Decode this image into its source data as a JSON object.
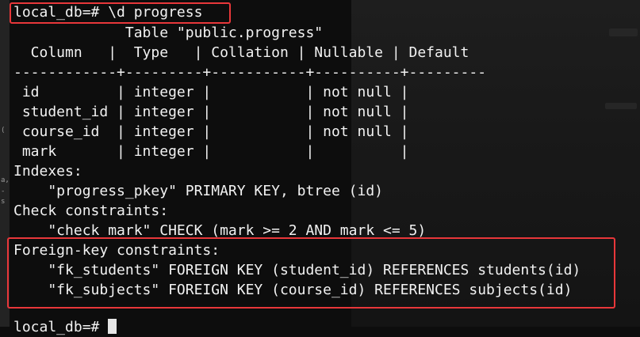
{
  "terminal": {
    "lines": [
      "local_db=# \\d progress",
      "             Table \"public.progress\"",
      "  Column   |  Type   | Collation | Nullable | Default",
      "------------+---------+-----------+----------+---------",
      " id         | integer |           | not null |",
      " student_id | integer |           | not null |",
      " course_id  | integer |           | not null |",
      " mark       | integer |           |          |",
      "Indexes:",
      "    \"progress_pkey\" PRIMARY KEY, btree (id)",
      "Check constraints:",
      "    \"check_mark\" CHECK (mark >= 2 AND mark <= 5)",
      "Foreign-key constraints:",
      "    \"fk_students\" FOREIGN KEY (student_id) REFERENCES students(id)",
      "    \"fk_subjects\" FOREIGN KEY (course_id) REFERENCES subjects(id)",
      "",
      "local_db=# "
    ]
  },
  "background_window": {
    "left_fragments": [
      "(",
      "a,",
      "-",
      "s"
    ]
  },
  "colors": {
    "terminal_bg": "#0d0d0d",
    "text": "#f2f2f2",
    "highlight_border": "#e8373a"
  }
}
